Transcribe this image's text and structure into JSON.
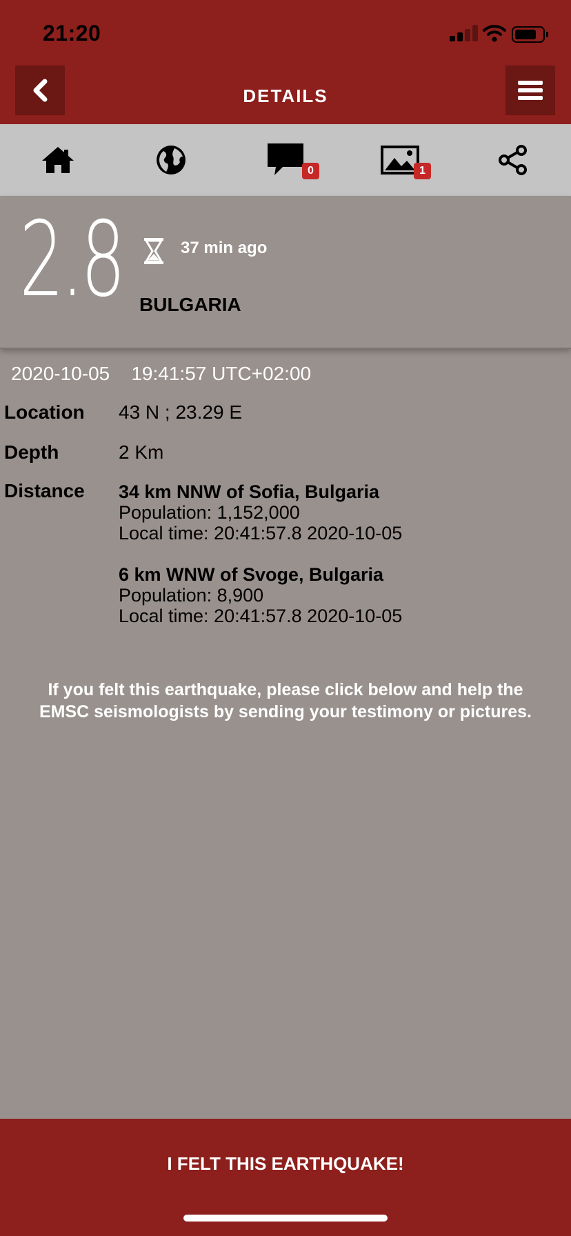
{
  "status": {
    "time": "21:20"
  },
  "header": {
    "title": "DETAILS"
  },
  "toolbar": {
    "comments_count": "0",
    "pictures_count": "1"
  },
  "quake": {
    "magnitude": "2.8",
    "time_ago": "37 min ago",
    "region": "BULGARIA",
    "date": "2020-10-05",
    "time": "19:41:57",
    "timezone": "UTC+02:00",
    "location_label": "Location",
    "location_value": "43 N ; 23.29 E",
    "depth_label": "Depth",
    "depth_value": "2 Km",
    "distance_label": "Distance",
    "distances": [
      {
        "title": "34 km NNW of Sofia, Bulgaria",
        "population": "Population: 1,152,000",
        "local_time": "Local time: 20:41:57.8 2020-10-05"
      },
      {
        "title": "6 km WNW of Svoge, Bulgaria",
        "population": "Population: 8,900",
        "local_time": "Local time: 20:41:57.8 2020-10-05"
      }
    ]
  },
  "invite": {
    "line1": "If you felt this earthquake, please click below and help the",
    "line2": "EMSC seismologists by sending your testimony or pictures."
  },
  "action": {
    "felt_label": "I FELT THIS EARTHQUAKE!"
  },
  "colors": {
    "brand": "#8d1f1c",
    "brand_dark": "#6b1714",
    "content_bg": "#99918e",
    "toolbar_bg": "#c4c4c4",
    "badge": "#c62828"
  }
}
